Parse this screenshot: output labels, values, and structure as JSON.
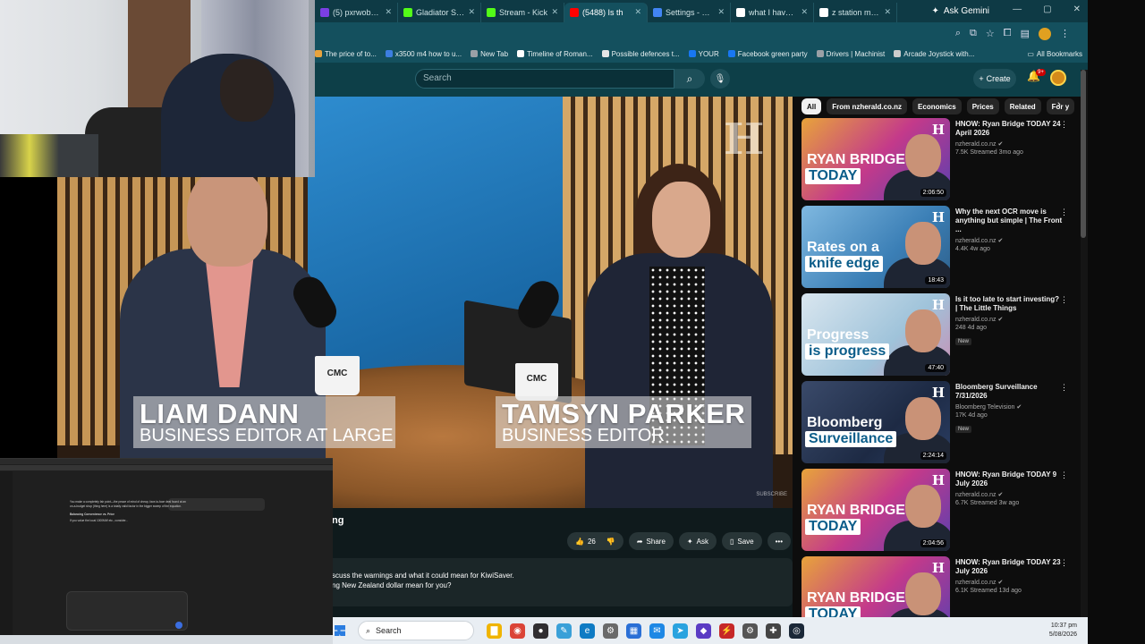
{
  "browser": {
    "tabs": [
      {
        "label": "(5) pxrwobbles",
        "color": "#7b3fe4",
        "active": false
      },
      {
        "label": "Gladiator Strea",
        "color": "#53fc18",
        "active": false
      },
      {
        "label": "Stream - Kick",
        "color": "#53fc18",
        "active": false
      },
      {
        "label": "(5488) Is th",
        "color": "#ff0000",
        "active": true
      },
      {
        "label": "Settings - Syst",
        "color": "#4285f4",
        "active": false
      },
      {
        "label": "what I have th",
        "color": "#ffffff",
        "active": false
      },
      {
        "label": "z station make",
        "color": "#ffffff",
        "active": false
      }
    ],
    "ask_gemini": "Ask Gemini",
    "bookmarks": [
      {
        "label": "The price of to...",
        "color": "#e7a33e"
      },
      {
        "label": "x3500 m4 how to u...",
        "color": "#3d7ee0"
      },
      {
        "label": "New Tab",
        "color": "#9aa0a6"
      },
      {
        "label": "Timeline of Roman...",
        "color": "#ffffff"
      },
      {
        "label": "Possible defences t...",
        "color": "#e5e5e5"
      },
      {
        "label": "YOUR",
        "color": "#1877f2"
      },
      {
        "label": "Facebook green party",
        "color": "#1877f2"
      },
      {
        "label": "Drivers | Machinist",
        "color": "#9aa0a6"
      },
      {
        "label": "Arcade Joystick with...",
        "color": "#cccccc"
      }
    ],
    "all_bookmarks": "All Bookmarks"
  },
  "youtube": {
    "search_placeholder": "Search",
    "create_label": "Create",
    "notification_count": "9+",
    "video": {
      "lower_third_left": {
        "name": "LIAM DANN",
        "role": "BUSINESS EDITOR AT LARGE"
      },
      "lower_third_right": {
        "name": "TAMSYN PARKER",
        "role": "BUSINESS EDITOR"
      },
      "mug_text": "CMC",
      "mug_subtext": "MARKETS",
      "watermark": "SUBSCRIBE"
    },
    "title_fragment": "ng",
    "actions": {
      "likes": "26",
      "share": "Share",
      "ask": "Ask",
      "save": "Save",
      "more": "•••"
    },
    "description": {
      "line1": "scuss the warnings and what it could mean for KiwiSaver.",
      "line2": "ng New Zealand dollar mean for you?"
    },
    "chips": [
      {
        "label": "All",
        "active": true
      },
      {
        "label": "From nzherald.co.nz",
        "active": false
      },
      {
        "label": "Economics",
        "active": false
      },
      {
        "label": "Prices",
        "active": false
      },
      {
        "label": "Related",
        "active": false
      },
      {
        "label": "For y",
        "active": false
      }
    ],
    "recommendations": [
      {
        "title": "HNOW: Ryan Bridge TODAY 24 April 2026",
        "channel": "nzherald.co.nz",
        "meta": "7.5K  Streamed 3mo ago",
        "duration": "2:06:50",
        "badge": "",
        "thumb_line1": "RYAN BRIDGE",
        "thumb_tag": "TODAY",
        "bg": "linear-gradient(135deg,#e8a43a,#c43a8a 50%,#5a3fb0)"
      },
      {
        "title": "Why the next OCR move is anything but simple | The Front ...",
        "channel": "nzherald.co.nz",
        "meta": "4.4K  4w ago",
        "duration": "18:43",
        "badge": "",
        "thumb_line1": "Rates on a",
        "thumb_tag": "knife edge",
        "bg": "linear-gradient(135deg,#7fb8e0,#3b7fb6 60%,#2e5f8a)"
      },
      {
        "title": "Is it too late to start investing? | The Little Things",
        "channel": "nzherald.co.nz",
        "meta": "248  4d ago",
        "duration": "47:40",
        "badge": "New",
        "thumb_line1": "Progress",
        "thumb_tag": "is progress",
        "bg": "linear-gradient(135deg,#d9e6ef,#9fc3da 60%,#c98fb4)"
      },
      {
        "title": "Bloomberg Surveillance 7/31/2026",
        "channel": "Bloomberg Television",
        "meta": "17K  4d ago",
        "duration": "2:24:14",
        "badge": "New",
        "thumb_line1": "Bloomberg",
        "thumb_tag": "Surveillance",
        "bg": "linear-gradient(135deg,#3a4a6a,#1d2a44 60%,#2b3e63)"
      },
      {
        "title": "HNOW: Ryan Bridge TODAY 9 July 2026",
        "channel": "nzherald.co.nz",
        "meta": "6.7K  Streamed 3w ago",
        "duration": "2:04:56",
        "badge": "",
        "thumb_line1": "RYAN BRIDGE",
        "thumb_tag": "TODAY",
        "bg": "linear-gradient(135deg,#e8a43a,#c43a8a 50%,#5a3fb0)"
      },
      {
        "title": "HNOW: Ryan Bridge TODAY 23 July 2026",
        "channel": "nzherald.co.nz",
        "meta": "6.1K  Streamed 13d ago",
        "duration": "",
        "badge": "",
        "thumb_line1": "RYAN BRIDGE",
        "thumb_tag": "TODAY",
        "bg": "linear-gradient(135deg,#e8a43a,#c43a8a 50%,#5a3fb0)"
      }
    ]
  },
  "mini_screen": {
    "paragraph1": "You make a completely fair point—the peace of mind of cheap, face-to-face deal found at an on-a-budget shop (thing here) is a totally valid factor in the bigger sweep of the equation.",
    "section_title": "Balancing Convenience vs. Price",
    "paragraph2": "If you value the local 1000MW etc., consider..."
  },
  "taskbar": {
    "search_label": "Search",
    "time": "10:37 pm",
    "date": "5/08/2026",
    "apps": [
      {
        "name": "file-explorer-icon",
        "color": "#f0b400",
        "glyph": "▇"
      },
      {
        "name": "chrome-icon",
        "color": "#db4437",
        "glyph": "◉"
      },
      {
        "name": "obs-icon",
        "color": "#302e31",
        "glyph": "●"
      },
      {
        "name": "paint-icon",
        "color": "#3aa0d8",
        "glyph": "✎"
      },
      {
        "name": "edge-icon",
        "color": "#0f7bc4",
        "glyph": "e"
      },
      {
        "name": "settings-icon",
        "color": "#6a6a6a",
        "glyph": "⚙"
      },
      {
        "name": "store-icon",
        "color": "#2a6fd6",
        "glyph": "▦"
      },
      {
        "name": "mail-icon",
        "color": "#1e88e5",
        "glyph": "✉"
      },
      {
        "name": "telegram-icon",
        "color": "#2aa3df",
        "glyph": "➤"
      },
      {
        "name": "app-purple-icon",
        "color": "#5b3cc4",
        "glyph": "◆"
      },
      {
        "name": "app-red-icon",
        "color": "#c62828",
        "glyph": "⚡"
      },
      {
        "name": "gear-dark-icon",
        "color": "#555555",
        "glyph": "⚙"
      },
      {
        "name": "gamepad-icon",
        "color": "#444444",
        "glyph": "✚"
      },
      {
        "name": "steam-icon",
        "color": "#1b2838",
        "glyph": "◎"
      }
    ]
  }
}
